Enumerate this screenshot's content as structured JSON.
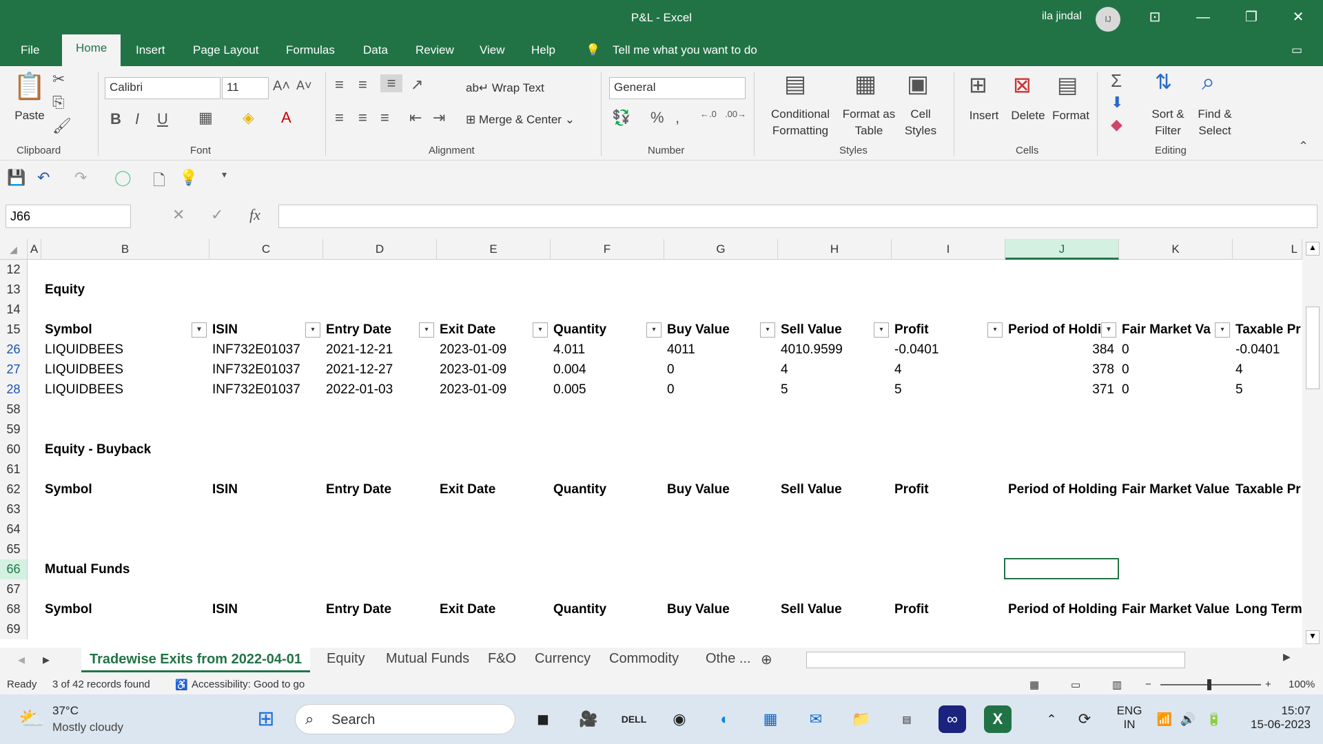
{
  "window": {
    "title": "P&L  -  Excel",
    "user": "ila jindal",
    "avatar": "IJ"
  },
  "menu": [
    "File",
    "Home",
    "Insert",
    "Page Layout",
    "Formulas",
    "Data",
    "Review",
    "View",
    "Help"
  ],
  "tell_me": "Tell me what you want to do",
  "ribbon": {
    "clipboard": {
      "paste": "Paste",
      "label": "Clipboard"
    },
    "font": {
      "name": "Calibri",
      "size": "11",
      "label": "Font"
    },
    "alignment": {
      "wrap": "Wrap Text",
      "merge": "Merge & Center",
      "label": "Alignment"
    },
    "number": {
      "format": "General",
      "label": "Number"
    },
    "styles": {
      "cond1": "Conditional",
      "cond2": "Formatting",
      "fmt1": "Format as",
      "fmt2": "Table",
      "cell1": "Cell",
      "cell2": "Styles",
      "label": "Styles"
    },
    "cells": {
      "insert": "Insert",
      "delete": "Delete",
      "format": "Format",
      "label": "Cells"
    },
    "editing": {
      "sort1": "Sort &",
      "sort2": "Filter",
      "find1": "Find &",
      "find2": "Select",
      "label": "Editing"
    }
  },
  "name_box": "J66",
  "columns": [
    "A",
    "B",
    "C",
    "D",
    "E",
    "F",
    "G",
    "H",
    "I",
    "J",
    "K",
    "L"
  ],
  "sections": {
    "equity": "Equity",
    "buyback": "Equity - Buyback",
    "mf": "Mutual Funds"
  },
  "headers": [
    "Symbol",
    "ISIN",
    "Entry Date",
    "Exit Date",
    "Quantity",
    "Buy Value",
    "Sell Value",
    "Profit",
    "Period of Holdi",
    "Fair Market Va",
    "Taxable Pr"
  ],
  "headers2": [
    "Symbol",
    "ISIN",
    "Entry Date",
    "Exit Date",
    "Quantity",
    "Buy Value",
    "Sell Value",
    "Profit",
    "Period of Holding",
    "Fair Market Value",
    "Taxable Pr"
  ],
  "headers3": [
    "Symbol",
    "ISIN",
    "Entry Date",
    "Exit Date",
    "Quantity",
    "Buy Value",
    "Sell Value",
    "Profit",
    "Period of Holding",
    "Fair Market Value",
    "Long Term"
  ],
  "rows": [
    [
      "LIQUIDBEES",
      "INF732E01037",
      "2021-12-21",
      "2023-01-09",
      "4.011",
      "4011",
      "4010.9599",
      "-0.0401",
      "384",
      "0",
      "-0.0401"
    ],
    [
      "LIQUIDBEES",
      "INF732E01037",
      "2021-12-27",
      "2023-01-09",
      "0.004",
      "0",
      "4",
      "4",
      "378",
      "0",
      "4"
    ],
    [
      "LIQUIDBEES",
      "INF732E01037",
      "2022-01-03",
      "2023-01-09",
      "0.005",
      "0",
      "5",
      "5",
      "371",
      "0",
      "5"
    ]
  ],
  "row_numbers": [
    "12",
    "13",
    "14",
    "15",
    "26",
    "27",
    "28",
    "58",
    "59",
    "60",
    "61",
    "62",
    "63",
    "64",
    "65",
    "66",
    "67",
    "68",
    "69"
  ],
  "sheets": [
    "Tradewise Exits from 2022-04-01",
    "Equity",
    "Mutual Funds",
    "F&O",
    "Currency",
    "Commodity",
    "Othe ..."
  ],
  "status": {
    "ready": "Ready",
    "records": "3 of 42 records found",
    "access": "Accessibility: Good to go",
    "zoom": "100%"
  },
  "taskbar": {
    "temp": "37°C",
    "weather": "Mostly cloudy",
    "search": "Search",
    "lang1": "ENG",
    "lang2": "IN",
    "time": "15:07",
    "date": "15-06-2023"
  },
  "colors": {
    "excel_green": "#217346"
  }
}
